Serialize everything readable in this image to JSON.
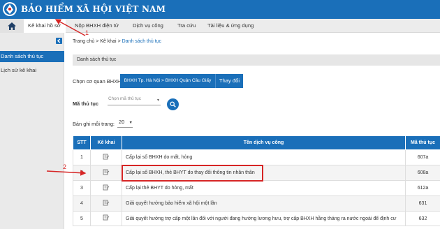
{
  "header": {
    "brand": "BẢO HIỂM XÃ HỘI VIỆT NAM",
    "color": "#1a6fb9"
  },
  "nav": {
    "home_icon": "home-icon",
    "items": [
      "Kê khai hồ sơ",
      "Nộp BHXH điện tử",
      "Dịch vụ công",
      "Tra cứu",
      "Tài liệu & ứng dụng"
    ]
  },
  "sidebar": {
    "toggle_icon": "collapse-arrow-icon",
    "items": [
      "Danh sách thủ tục",
      "Lịch sử kê khai"
    ]
  },
  "breadcrumb": {
    "home": "Trang chủ",
    "sep": ">",
    "mid": "Kê khai",
    "current": "Danh sách thủ tục"
  },
  "panel": {
    "title": "Danh sách thủ tục"
  },
  "agency": {
    "label": "Chọn cơ quan BHXH:",
    "value": "BHXH Tp. Hà Nội > BHXH Quận Cầu Giấy",
    "change_label": "Thay đổi"
  },
  "filter": {
    "label": "Mã thủ tục",
    "placeholder": "Chọn mã thủ tục",
    "search_icon": "search-icon"
  },
  "pagesize": {
    "label": "Bản ghi mỗi trang:",
    "value": "20"
  },
  "table": {
    "headers": [
      "STT",
      "Kê khai",
      "Tên dịch vụ công",
      "Mã thủ tục"
    ],
    "rows": [
      {
        "stt": "1",
        "name": "Cấp lại sổ BHXH do mất, hỏng",
        "code": "607a"
      },
      {
        "stt": "2",
        "name": "Cấp lại sổ BHXH, thẻ BHYT do thay đổi thông tin nhân thân",
        "code": "608a"
      },
      {
        "stt": "3",
        "name": "Cấp lại thẻ BHYT do hỏng, mất",
        "code": "612a"
      },
      {
        "stt": "4",
        "name": "Giải quyết hưởng bảo hiểm xã hội một lần",
        "code": "631"
      },
      {
        "stt": "5",
        "name": "Giải quyết hưởng trợ cấp một lần đối với người đang hưởng lương hưu, trợ cấp BHXH hằng tháng ra nước ngoài để định cư",
        "code": "632"
      }
    ]
  },
  "annotations": {
    "step1": "1",
    "step2": "2",
    "color": "#d62525"
  }
}
